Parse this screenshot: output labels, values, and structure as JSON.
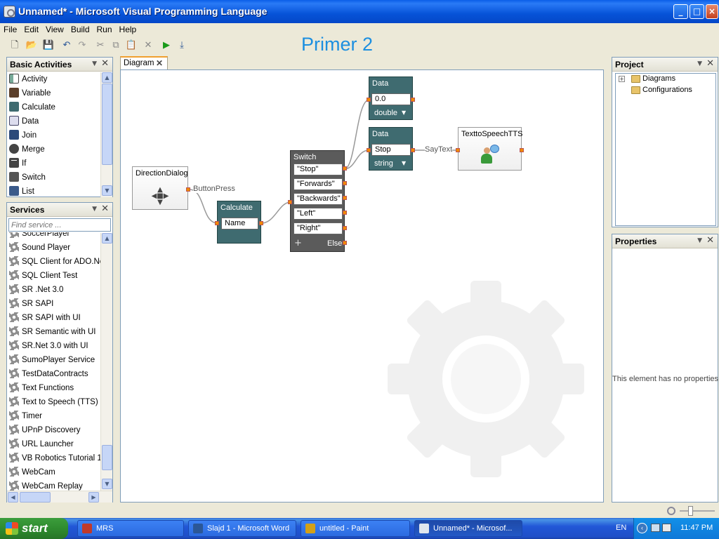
{
  "window": {
    "title": "Unnamed* - Microsoft Visual Programming Language"
  },
  "menu": [
    "File",
    "Edit",
    "View",
    "Build",
    "Run",
    "Help"
  ],
  "overlay_text": "Primer 2",
  "basic_activities": {
    "title": "Basic Activities",
    "items": [
      {
        "label": "Activity",
        "icon": "activity-icon"
      },
      {
        "label": "Variable",
        "icon": "variable-icon"
      },
      {
        "label": "Calculate",
        "icon": "calculate-icon"
      },
      {
        "label": "Data",
        "icon": "data-icon"
      },
      {
        "label": "Join",
        "icon": "join-icon"
      },
      {
        "label": "Merge",
        "icon": "merge-icon"
      },
      {
        "label": "If",
        "icon": "if-icon"
      },
      {
        "label": "Switch",
        "icon": "switch-icon"
      },
      {
        "label": "List",
        "icon": "list-icon"
      }
    ]
  },
  "services": {
    "title": "Services",
    "search_placeholder": "Find service ...",
    "items": [
      "SoccerPlayer",
      "Sound Player",
      "SQL Client for ADO.Net",
      "SQL Client Test",
      "SR .Net 3.0",
      "SR SAPI",
      "SR SAPI with UI",
      "SR Semantic with UI",
      "SR.Net 3.0 with UI",
      "SumoPlayer Service",
      "TestDataContracts",
      "Text Functions",
      "Text to Speech (TTS)",
      "Timer",
      "UPnP Discovery",
      "URL Launcher",
      "VB Robotics Tutorial 1",
      "WebCam",
      "WebCam Replay"
    ]
  },
  "tab": {
    "label": "Diagram"
  },
  "diagram": {
    "direction_dialog": {
      "title": "DirectionDialog"
    },
    "wire_button_press": "ButtonPress",
    "calculate": {
      "title": "Calculate",
      "value": "Name"
    },
    "switch": {
      "title": "Switch",
      "cases": [
        "\"Stop\"",
        "\"Forwards\"",
        "\"Backwards\"",
        "\"Left\"",
        "\"Right\""
      ],
      "add": "+",
      "else": "Else"
    },
    "data1": {
      "title": "Data",
      "value": "0.0",
      "type": "double"
    },
    "data2": {
      "title": "Data",
      "value": "Stop",
      "type": "string"
    },
    "wire_say_text": "SayText",
    "tts": {
      "title": "TexttoSpeechTTS"
    }
  },
  "project": {
    "title": "Project",
    "items": [
      "Diagrams",
      "Configurations"
    ],
    "expander": "+"
  },
  "properties": {
    "title": "Properties",
    "empty_text": "This element has no properties"
  },
  "taskbar": {
    "start": "start",
    "tasks": [
      {
        "label": "MRS",
        "color": "#c0392b"
      },
      {
        "label": "Slajd 1 - Microsoft Word",
        "color": "#2b5797"
      },
      {
        "label": "untitled - Paint",
        "color": "#d4a017"
      },
      {
        "label": "Unnamed* - Microsof...",
        "color": "#7f8c8d"
      }
    ],
    "lang": "EN",
    "clock": "11:47 PM"
  },
  "colors": {
    "accent": "#1c8fe0",
    "port": "#f08a00",
    "node_dark": "#3f6b70"
  }
}
